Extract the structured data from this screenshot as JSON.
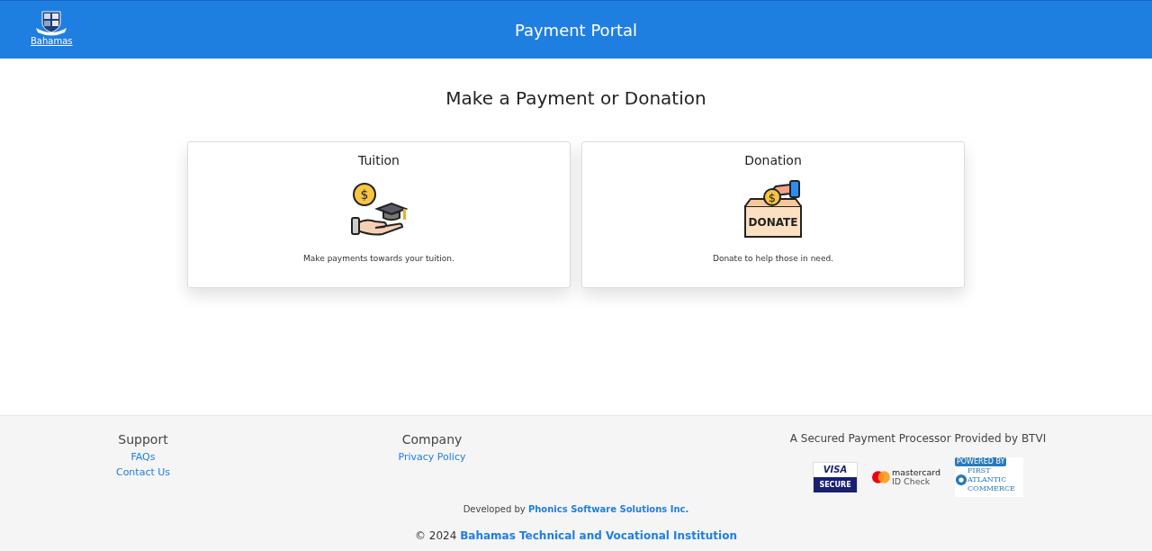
{
  "header": {
    "logo_text": "Bahamas",
    "title": "Payment Portal"
  },
  "heading": "Make a Payment or Donation",
  "cards": [
    {
      "kind": "tuition",
      "title": "Tuition",
      "coin_symbol": "$",
      "description": "Make payments towards your tuition."
    },
    {
      "kind": "donation",
      "title": "Donation",
      "coin_symbol": "$",
      "icon_text": "DONATE",
      "description": "Donate to help those in need."
    }
  ],
  "footer": {
    "columns": [
      {
        "title": "Support",
        "links": [
          "FAQs",
          "Contact Us"
        ]
      },
      {
        "title": "Company",
        "links": [
          "Privacy Policy"
        ]
      }
    ],
    "secured_text": "A Secured Payment Processor Provided by BTVI",
    "badges": [
      {
        "kind": "visa",
        "lines": [
          "VISA",
          "SECURE"
        ]
      },
      {
        "kind": "mastercard",
        "lines": [
          "mastercard",
          "ID Check"
        ]
      },
      {
        "kind": "fac",
        "lines": [
          "POWERED BY",
          "FIRST",
          "ATLANTIC",
          "COMMERCE"
        ]
      }
    ],
    "developed_prefix": "Developed by",
    "developer": "Phonics Software Solutions Inc.",
    "copyright_prefix": "© 2024",
    "institution": "Bahamas Technical and Vocational Institution"
  }
}
